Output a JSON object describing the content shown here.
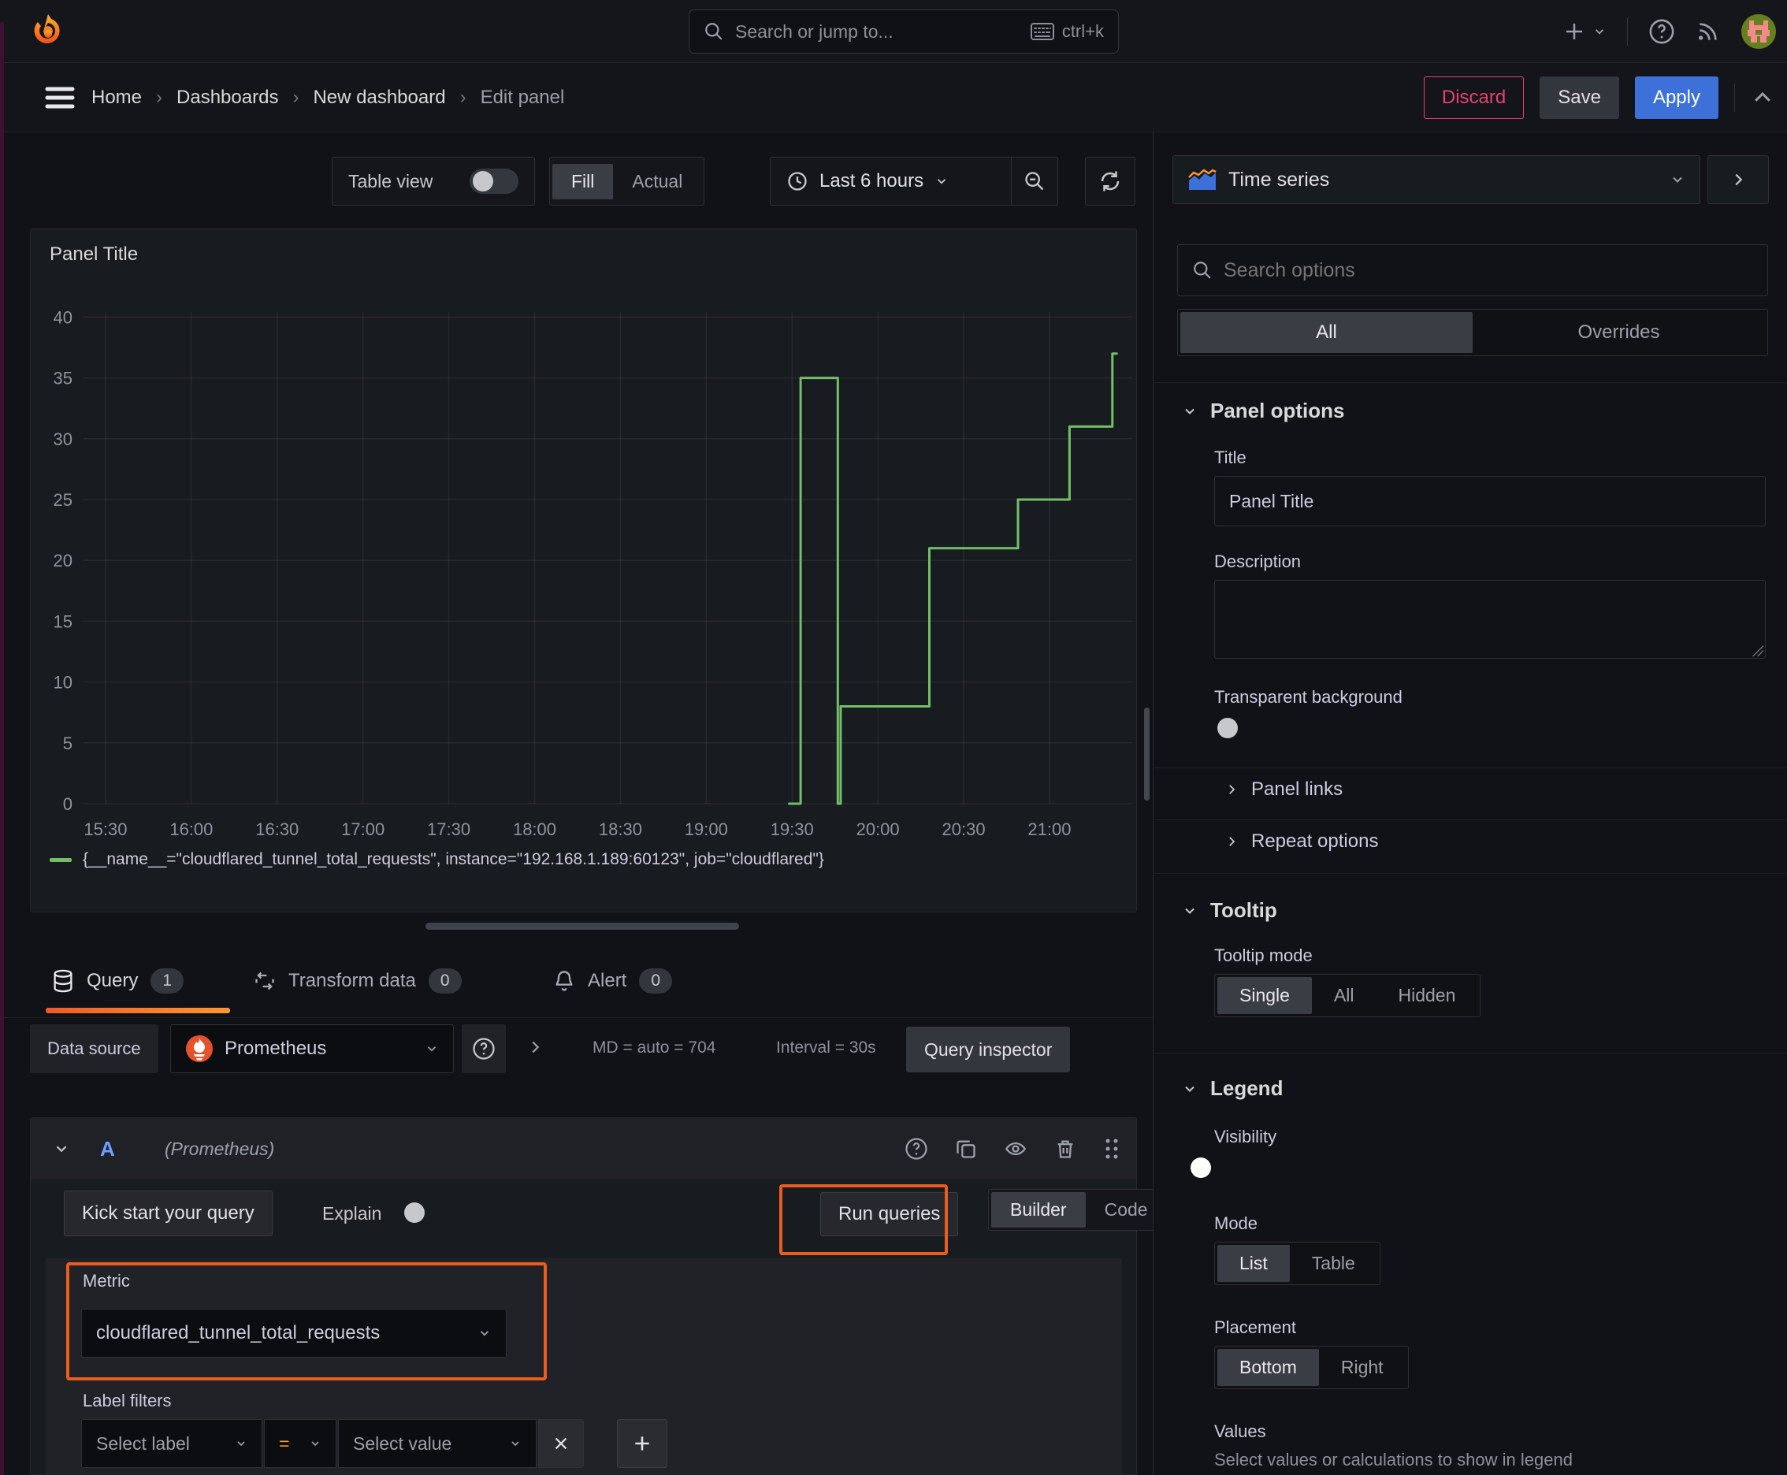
{
  "topbar": {
    "search_placeholder": "Search or jump to...",
    "shortcut": "ctrl+k"
  },
  "breadcrumb": {
    "items": [
      "Home",
      "Dashboards",
      "New dashboard",
      "Edit panel"
    ]
  },
  "nav_actions": {
    "discard": "Discard",
    "save": "Save",
    "apply": "Apply"
  },
  "panel_toolbar": {
    "table_view": "Table view",
    "fill": "Fill",
    "actual": "Actual",
    "time_range": "Last 6 hours"
  },
  "viz_picker": {
    "label": "Time series"
  },
  "panel": {
    "title": "Panel Title"
  },
  "chart_data": {
    "type": "line",
    "line_style": "step-after",
    "title": "Panel Title",
    "xlabel": "",
    "ylabel": "",
    "x_ticks": [
      "15:30",
      "16:00",
      "16:30",
      "17:00",
      "17:30",
      "18:00",
      "18:30",
      "19:00",
      "19:30",
      "20:00",
      "20:30",
      "21:00"
    ],
    "y_ticks": [
      0,
      5,
      10,
      15,
      20,
      25,
      30,
      35,
      40
    ],
    "ylim": [
      0,
      40.4
    ],
    "x_range": [
      "15:22",
      "21:29"
    ],
    "grid": true,
    "legend_position": "bottom",
    "series": [
      {
        "name": "{__name__=\"cloudflared_tunnel_total_requests\", instance=\"192.168.1.189:60123\", job=\"cloudflared\"}",
        "color": "#73bf69",
        "step_points": [
          [
            "19:29",
            0
          ],
          [
            "19:33",
            35
          ],
          [
            "19:46",
            0
          ],
          [
            "19:47",
            8
          ],
          [
            "20:18",
            21
          ],
          [
            "20:49",
            25
          ],
          [
            "21:07",
            31
          ],
          [
            "21:22",
            37
          ]
        ]
      }
    ]
  },
  "tabs": {
    "query": {
      "label": "Query",
      "count": "1"
    },
    "transform": {
      "label": "Transform data",
      "count": "0"
    },
    "alert": {
      "label": "Alert",
      "count": "0"
    }
  },
  "datasource_row": {
    "label": "Data source",
    "value": "Prometheus",
    "stats_md": "MD = auto = 704",
    "stats_interval": "Interval = 30s",
    "inspector": "Query inspector"
  },
  "query_editor": {
    "refid": "A",
    "datasource_hint": "(Prometheus)",
    "kick_start": "Kick start your query",
    "explain": "Explain",
    "run_queries": "Run queries",
    "builder": "Builder",
    "code": "Code",
    "metric_label": "Metric",
    "metric_value": "cloudflared_tunnel_total_requests",
    "label_filters_label": "Label filters",
    "select_label": "Select label",
    "operator": "=",
    "select_value": "Select value"
  },
  "options_pane": {
    "search_placeholder": "Search options",
    "tab_all": "All",
    "tab_overrides": "Overrides",
    "panel_options": {
      "title": "Panel options",
      "title_label": "Title",
      "title_value": "Panel Title",
      "description_label": "Description",
      "transparent_label": "Transparent background"
    },
    "panel_links": "Panel links",
    "repeat_options": "Repeat options",
    "tooltip": {
      "title": "Tooltip",
      "mode_label": "Tooltip mode",
      "single": "Single",
      "all": "All",
      "hidden": "Hidden"
    },
    "legend": {
      "title": "Legend",
      "visibility_label": "Visibility",
      "mode_label": "Mode",
      "list": "List",
      "table": "Table",
      "placement_label": "Placement",
      "bottom": "Bottom",
      "right": "Right",
      "values_label": "Values",
      "values_desc": "Select values or calculations to show in legend"
    }
  },
  "colors": {
    "series_green": "#73bf69",
    "primary_blue": "#3d71d9",
    "danger_pink": "#e5426f",
    "highlight_orange": "#ea5d1f",
    "tab_underline_start": "#f05a28",
    "tab_underline_end": "#ff9830",
    "prometheus_orange": "#e6522c"
  }
}
